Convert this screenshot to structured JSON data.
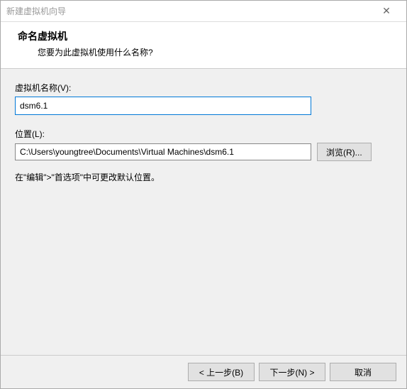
{
  "window": {
    "title": "新建虚拟机向导",
    "close_icon": "✕"
  },
  "header": {
    "heading": "命名虚拟机",
    "subheading": "您要为此虚拟机使用什么名称?"
  },
  "form": {
    "name_label": "虚拟机名称(V):",
    "name_value": "dsm6.1",
    "location_label": "位置(L):",
    "location_value": "C:\\Users\\youngtree\\Documents\\Virtual Machines\\dsm6.1",
    "browse_label": "浏览(R)...",
    "hint": "在\"编辑\">\"首选项\"中可更改默认位置。"
  },
  "footer": {
    "back": "< 上一步(B)",
    "next": "下一步(N) >",
    "cancel": "取消"
  }
}
